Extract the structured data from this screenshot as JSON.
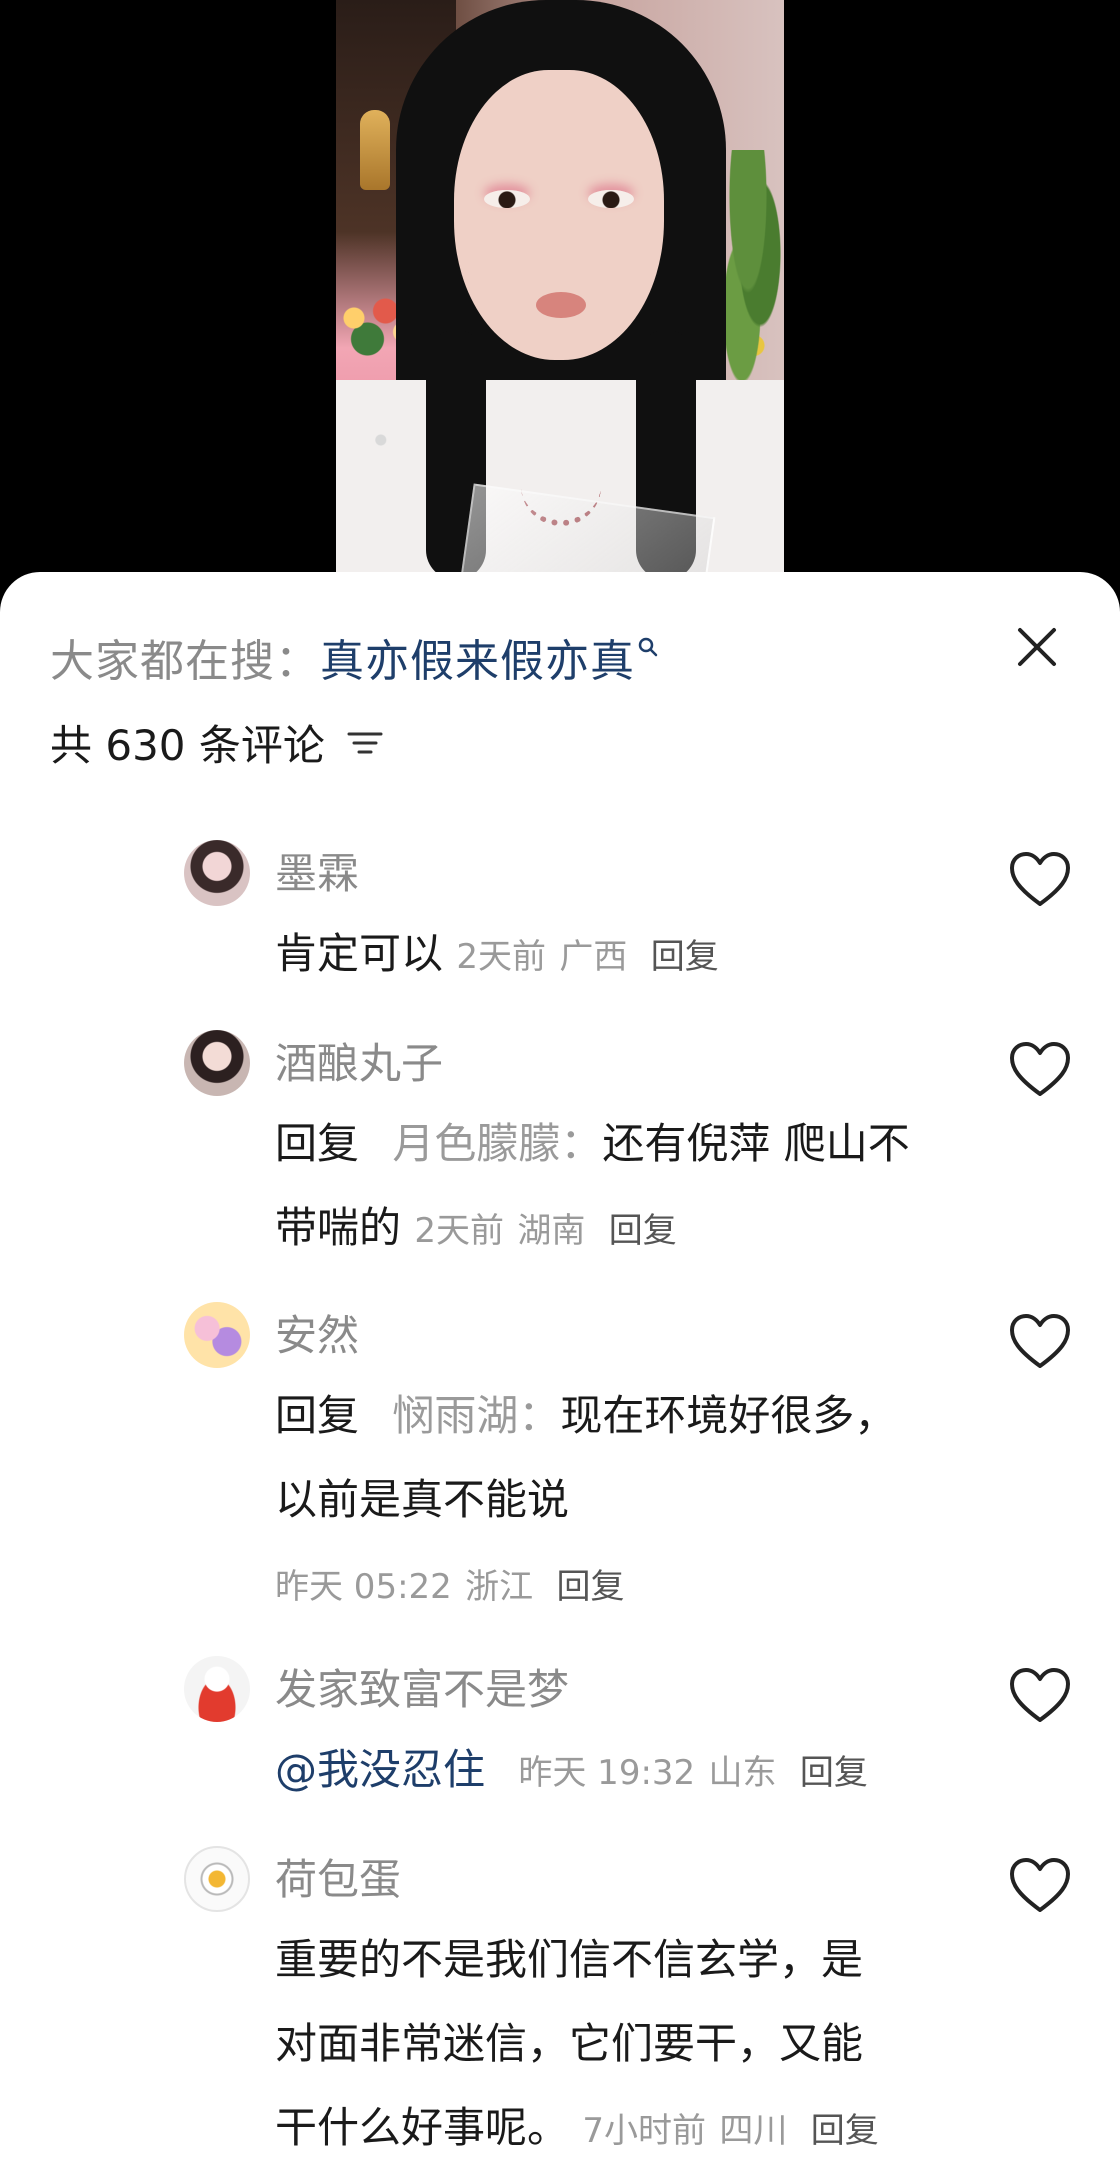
{
  "video": {
    "description_icon": "live-stream-video-frame"
  },
  "search": {
    "prefix": "大家都在搜：",
    "term": "真亦假来假亦真"
  },
  "comments_header": {
    "count_label": "共 630 条评论"
  },
  "comments": [
    {
      "user": "墨霖",
      "text": "肯定可以",
      "time": "2天前",
      "location": "广西",
      "reply_label": "回复"
    },
    {
      "user": "酒酿丸子",
      "reply_prefix": "回复",
      "reply_to": "月色朦朦：",
      "text_line1": "还有倪萍 爬山不",
      "text_line2": "带喘的",
      "time": "2天前",
      "location": "湖南",
      "reply_label": "回复"
    },
    {
      "user": "安然",
      "reply_prefix": "回复",
      "reply_to": "悯雨湖：",
      "text_line1": "现在环境好很多，",
      "text_line2": "以前是真不能说",
      "time": "昨天 05:22",
      "location": "浙江",
      "reply_label": "回复"
    },
    {
      "user": "发家致富不是梦",
      "mention": "@我没忍住",
      "time": "昨天 19:32",
      "location": "山东",
      "reply_label": "回复"
    },
    {
      "user": "荷包蛋",
      "text_line1": "重要的不是我们信不信玄学，是",
      "text_line2": "对面非常迷信，它们要干，又能",
      "text_line3": "干什么好事呢。",
      "time": "7小时前",
      "location": "四川",
      "reply_label": "回复"
    }
  ],
  "colors": {
    "link": "#1e3e6a",
    "muted": "#8a8a8a",
    "text": "#1a1a1a"
  }
}
